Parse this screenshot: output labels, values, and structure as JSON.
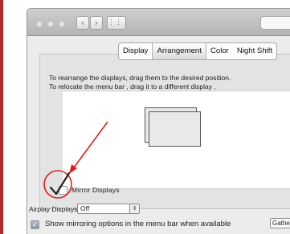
{
  "tabs": {
    "display": "Display",
    "arrangement": "Arrangement",
    "color": "Color",
    "night_shift": "Night Shift"
  },
  "instructions": {
    "line1": "To rearrange the displays, drag them to the desired position.",
    "line2": "To relocate the menu bar , drag it to a different display ."
  },
  "mirror": {
    "label": "Mirror Displays",
    "checked": false
  },
  "airplay": {
    "label": "Airplay Displays :",
    "value": "Off"
  },
  "show_option": {
    "label": "Show mirroring options in the menu bar when available",
    "checked": true
  },
  "gather_button": {
    "label": "Gather Windows"
  },
  "colors": {
    "annotation": "#e02020"
  }
}
